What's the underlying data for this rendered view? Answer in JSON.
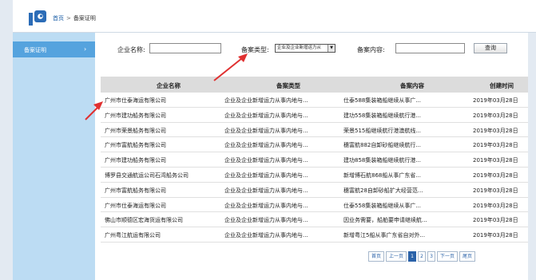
{
  "header": {
    "breadcrumb_home": "首页",
    "breadcrumb_sep": ">",
    "breadcrumb_current": "备案证明"
  },
  "sidebar": {
    "items": [
      {
        "label": "备案证明",
        "chevron": "›"
      }
    ]
  },
  "filters": {
    "company_label": "企业名称:",
    "company_value": "",
    "type_label": "备案类型:",
    "type_selected": "企业及企业新增运力从",
    "content_label": "备案内容:",
    "content_value": "",
    "search_button": "查询"
  },
  "table": {
    "headers": [
      "企业名称",
      "备案类型",
      "备案内容",
      "创建时间"
    ],
    "rows": [
      [
        "广州市仕泰海运有限公司",
        "企业及企业新增运力从事内地与...",
        "仕泰588集装箱船继续从事广...",
        "2019年03月28日"
      ],
      [
        "广州市建功船务有限公司",
        "企业及企业新增运力从事内地与...",
        "建功558集装箱船继续航行港...",
        "2019年03月28日"
      ],
      [
        "广州市荣景船务有限公司",
        "企业及企业新增运力从事内地与...",
        "荣景515船继续航行港澳航线...",
        "2019年03月28日"
      ],
      [
        "广州市富航船务有限公司",
        "企业及企业新增运力从事内地与...",
        "穗富航882自卸砂船继续航行...",
        "2019年03月28日"
      ],
      [
        "广州市建功船务有限公司",
        "企业及企业新增运力从事内地与...",
        "建功858集装箱船继续航行港...",
        "2019年03月28日"
      ],
      [
        "博罗县交通航运公司石湾船务公司",
        "企业及企业新增运力从事内地与...",
        "新增博石航868船从事广东省...",
        "2019年03月28日"
      ],
      [
        "广州市富航船务有限公司",
        "企业及企业新增运力从事内地与...",
        "穗富航28自卸砂船扩大经营范...",
        "2019年03月28日"
      ],
      [
        "广州市仕泰海运有限公司",
        "企业及企业新增运力从事内地与...",
        "仕泰558集装箱船继续从事广...",
        "2019年03月28日"
      ],
      [
        "佛山市顺德区宏海货运有限公司",
        "企业及企业新增运力从事内地与...",
        "因业务需要，船舶要申请继续航...",
        "2019年03月28日"
      ],
      [
        "广州粤江航运有限公司",
        "企业及企业新增运力从事内地与...",
        "新增粤江5船从事广东省自对外...",
        "2019年03月28日"
      ]
    ]
  },
  "pagination": {
    "first": "首页",
    "prev": "上一页",
    "pages": [
      "1",
      "2",
      "3"
    ],
    "current": "1",
    "next": "下一页",
    "last": "尾页"
  },
  "colors": {
    "accent": "#2a62a8",
    "sidebar_bg": "#bcdcf3",
    "sidebar_active": "#55a3de",
    "arrow": "#e03030"
  }
}
